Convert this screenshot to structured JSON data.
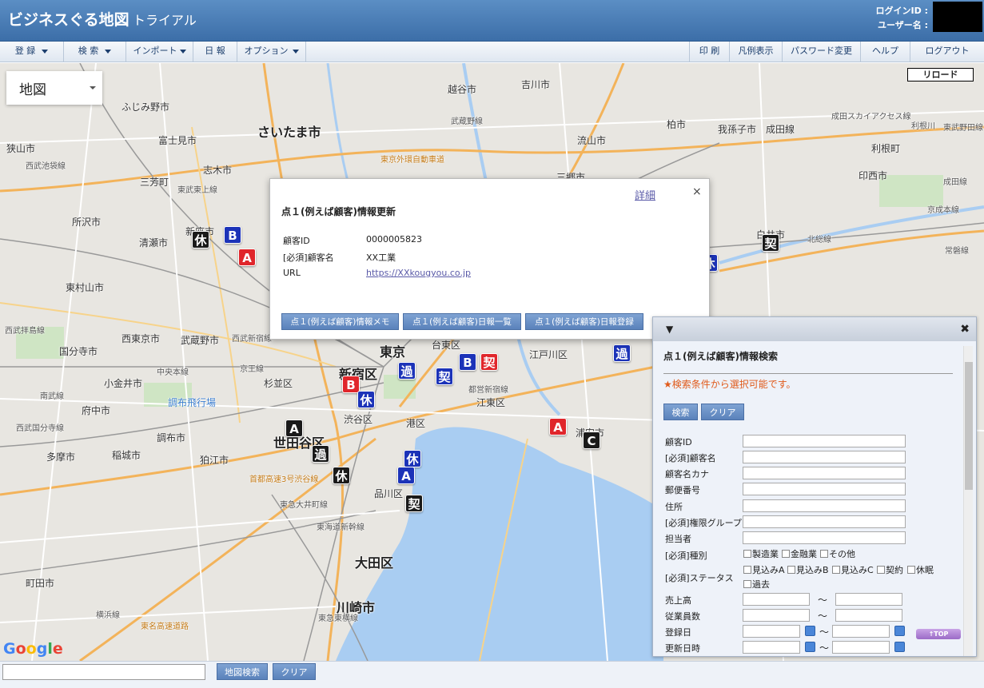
{
  "header": {
    "title": "ビジネスぐる地図",
    "subtitle": "トライアル",
    "login_id_label": "ログインID :",
    "user_name_label": "ユーザー名 :"
  },
  "nav": {
    "left": [
      "登 録",
      "検 索",
      "インポート",
      "日 報",
      "オプション"
    ],
    "right": [
      "印 刷",
      "凡例表示",
      "パスワード変更",
      "ヘルプ",
      "ログアウト"
    ]
  },
  "map": {
    "type_label": "地図",
    "reload_label": "リロード",
    "google_logo": "Google",
    "labels": {
      "big": [
        "さいたま市",
        "大田区",
        "川崎市",
        "世田谷区",
        "新宿区",
        "東京"
      ],
      "city": [
        "越谷市",
        "吉川市",
        "ふじみ野市",
        "富士見市",
        "志木市",
        "三芳町",
        "狭山市",
        "所沢市",
        "清瀬市",
        "新座市",
        "東村山市",
        "西東京市",
        "武蔵野市",
        "国分寺市",
        "小金井市",
        "府中市",
        "調布市",
        "稲城市",
        "多摩市",
        "狛江市",
        "町田市",
        "柏市",
        "我孫子市",
        "成田線",
        "流山市",
        "三郷市",
        "印西市",
        "白井市",
        "杉並区",
        "渋谷区",
        "港区",
        "品川区",
        "江東区",
        "江戸川区",
        "台東区",
        "浦安市",
        "利根町",
        "利根川",
        "調布飛行場"
      ],
      "rail": [
        "武蔵野線",
        "東京外環自動車道",
        "東武東上線",
        "西武池袋線",
        "西武新宿線",
        "西武拝島線",
        "中央本線",
        "南武線",
        "京王線",
        "横浜線",
        "東急東横線",
        "都営新宿線",
        "北総線",
        "成田線",
        "常磐線",
        "東海道新幹線",
        "東急大井町線",
        "首都高速3号渋谷線",
        "東名高速道路",
        "東武野田線",
        "西武国分寺線",
        "成田スカイアクセス線",
        "京成本線"
      ]
    },
    "markers": [
      "休",
      "B",
      "A",
      "B",
      "休",
      "A",
      "過",
      "休",
      "休",
      "A",
      "契",
      "過",
      "契",
      "B",
      "契",
      "過",
      "休",
      "A",
      "C",
      "契"
    ]
  },
  "popup": {
    "detail_link": "詳細",
    "close": "×",
    "title": "点１(例えば顧客)情報更新",
    "fields": [
      {
        "label": "顧客ID",
        "value": "0000005823"
      },
      {
        "label": "[必須]顧客名",
        "value": "XX工業"
      },
      {
        "label": "URL",
        "value": "https://XXkougyou.co.jp"
      }
    ],
    "buttons": [
      "点１(例えば顧客)情報メモ",
      "点１(例えば顧客)日報一覧",
      "点１(例えば顧客)日報登録"
    ]
  },
  "search_panel": {
    "collapse_icon": "▼",
    "close_icon": "✖",
    "title": "点１(例えば顧客)情報検索",
    "note": "★検索条件から選択可能です。",
    "search_btn": "検索",
    "clear_btn": "クリア",
    "fields": [
      "顧客ID",
      "[必須]顧客名",
      "顧客名カナ",
      "郵便番号",
      "住所",
      "[必須]権限グループ",
      "担当者"
    ],
    "type_label": "[必須]種別",
    "type_options": [
      "製造業",
      "金融業",
      "その他"
    ],
    "status_label": "[必須]ステータス",
    "status_options": [
      "見込みA",
      "見込みB",
      "見込みC",
      "契約",
      "休眠",
      "過去"
    ],
    "range_fields": [
      "売上高",
      "従業員数"
    ],
    "date_fields": [
      "登録日",
      "更新日時"
    ],
    "tilde": "～",
    "to_top": "↑TOP"
  },
  "bottom": {
    "map_search_btn": "地図検索",
    "clear_btn": "クリア"
  },
  "colors": {
    "header": "#3c6ea8",
    "marker_black": "#1a1a1a",
    "marker_blue": "#1c33b8",
    "marker_red": "#e0262b",
    "note": "#e05a1a"
  }
}
